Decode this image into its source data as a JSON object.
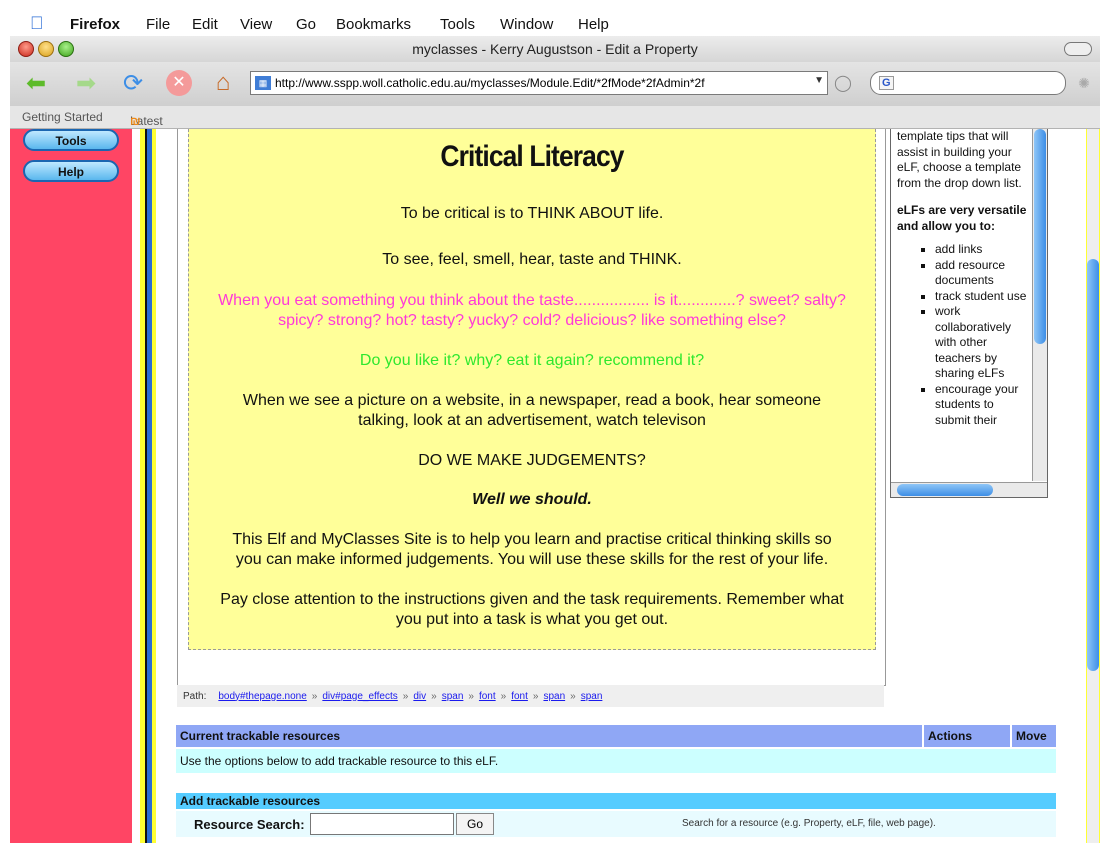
{
  "menubar": {
    "app": "Firefox",
    "items": [
      "File",
      "Edit",
      "View",
      "Go",
      "Bookmarks",
      "Tools",
      "Window",
      "Help"
    ]
  },
  "window": {
    "title": "myclasses - Kerry Augustson - Edit a Property"
  },
  "toolbar": {
    "url": "http://www.sspp.woll.catholic.edu.au/myclasses/Module.Edit/*2fMode*2fAdmin*2f",
    "search_placeholder": ""
  },
  "bookmarks": {
    "items": [
      "Getting Started",
      "Latest Headlines"
    ]
  },
  "nav": {
    "tools": "Tools",
    "help": "Help"
  },
  "content": {
    "title": "Critical Literacy",
    "p1": "To be critical is to THINK ABOUT life.",
    "p2": "To see, feel, smell, hear, taste and THINK.",
    "p3a": "When you eat something you think about the taste................. is it.............? sweet? salty?",
    "p3b": "spicy? strong? hot? tasty? yucky? cold? delicious? like something else?",
    "p4": "Do you like it? why? eat it again? recommend it?",
    "p5a": "When we see a picture on a website, in a newspaper, read a book, hear someone",
    "p5b": "talking, look at an advertisement, watch televison",
    "p6": "DO WE MAKE JUDGEMENTS?",
    "p7": "Well we should.",
    "p8a": "This Elf and MyClasses Site is to help you learn and practise critical thinking skills so",
    "p8b": "you can make informed judgements. You will use these skills for the rest of your life.",
    "p9a": "Pay close attention to the instructions given and the task requirements. Remember what",
    "p9b": "you put into a task is what you get out."
  },
  "path": {
    "label": "Path:",
    "items": [
      "body#thepage.none",
      "div#page_effects",
      "div",
      "span",
      "font",
      "font",
      "span",
      "span"
    ]
  },
  "sidebar": {
    "intro": "template tips that will assist in building your eLF, choose a template from the drop down list.",
    "heading": "eLFs are very versatile and allow you to:",
    "items": [
      "add links",
      "add resource documents",
      "track student use",
      "work collaboratively with other teachers by sharing eLFs",
      "encourage your students to submit their"
    ]
  },
  "resources": {
    "header": "Current trackable resources",
    "actions": "Actions",
    "move": "Move",
    "info": "Use the options below to add trackable resource to this eLF.",
    "add_header": "Add trackable resources",
    "search_label": "Resource Search:",
    "go": "Go",
    "hint": "Search for a resource (e.g. Property, eLF, file, web page)."
  }
}
